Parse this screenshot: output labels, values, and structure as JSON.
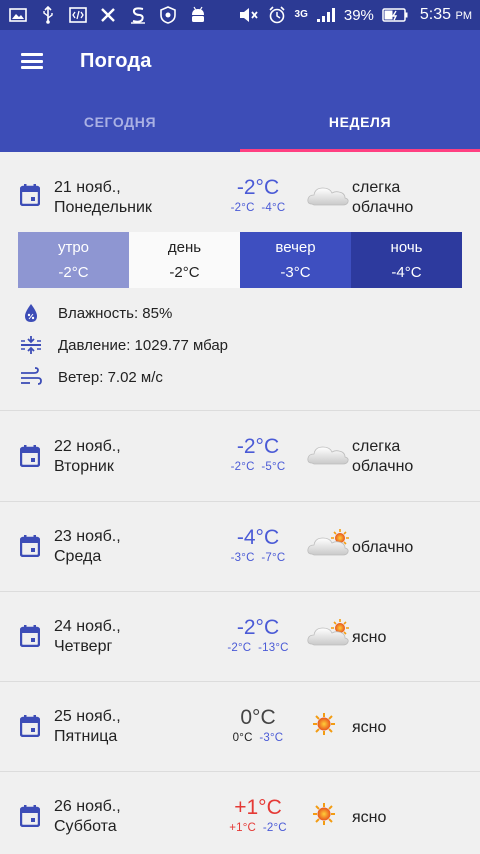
{
  "status_bar": {
    "battery": "39%",
    "time": "5:35",
    "ampm": "PM",
    "network": "3G"
  },
  "app_bar": {
    "title": "Погода"
  },
  "tabs": [
    {
      "label": "СЕГОДНЯ",
      "active": false
    },
    {
      "label": "НЕДЕЛЯ",
      "active": true
    }
  ],
  "first_day": {
    "date": "21 нояб.,",
    "weekday": "Понедельник",
    "temp": "-2°C",
    "temp_high": "-2°C",
    "temp_low": "-4°C",
    "condition_line1": "слегка",
    "condition_line2": "облачно",
    "icon": "cloud-icon",
    "parts": [
      {
        "label": "утро",
        "value": "-2°C",
        "bg": "#8e96d2",
        "fg": "#ffffff"
      },
      {
        "label": "день",
        "value": "-2°C",
        "bg": "#fafafa",
        "fg": "#222222"
      },
      {
        "label": "вечер",
        "value": "-3°C",
        "bg": "#3e4fc0",
        "fg": "#ffffff"
      },
      {
        "label": "ночь",
        "value": "-4°C",
        "bg": "#2d3a9e",
        "fg": "#ffffff"
      }
    ],
    "humidity": "Влажность: 85%",
    "pressure": "Давление: 1029.77 мбар",
    "wind": "Ветер: 7.02 м/с"
  },
  "days": [
    {
      "date": "22 нояб.,",
      "weekday": "Вторник",
      "temp": "-2°C",
      "temp_high": "-2°C",
      "temp_low": "-5°C",
      "condition_line1": "слегка",
      "condition_line2": "облачно",
      "icon": "cloud-icon",
      "tone": "cold"
    },
    {
      "date": "23 нояб.,",
      "weekday": "Среда",
      "temp": "-4°C",
      "temp_high": "-3°C",
      "temp_low": "-7°C",
      "condition_line1": "облачно",
      "condition_line2": "",
      "icon": "cloud-sun-icon",
      "tone": "cold"
    },
    {
      "date": "24 нояб.,",
      "weekday": "Четверг",
      "temp": "-2°C",
      "temp_high": "-2°C",
      "temp_low": "-13°C",
      "condition_line1": "ясно",
      "condition_line2": "",
      "icon": "cloud-sun-icon",
      "tone": "cold"
    },
    {
      "date": "25 нояб.,",
      "weekday": "Пятница",
      "temp": "0°C",
      "temp_high": "0°C",
      "temp_low": "-3°C",
      "condition_line1": "ясно",
      "condition_line2": "",
      "icon": "sun-icon",
      "tone": "neutral"
    },
    {
      "date": "26 нояб.,",
      "weekday": "Суббота",
      "temp": "+1°C",
      "temp_high": "+1°C",
      "temp_low": "-2°C",
      "condition_line1": "ясно",
      "condition_line2": "",
      "icon": "sun-icon",
      "tone": "warm"
    }
  ],
  "colors": {
    "primary": "#3d4db7",
    "status_bar": "#2c3a94",
    "accent": "#ff4081",
    "cold_temp": "#4a5ad6",
    "warm_temp": "#e53935"
  }
}
